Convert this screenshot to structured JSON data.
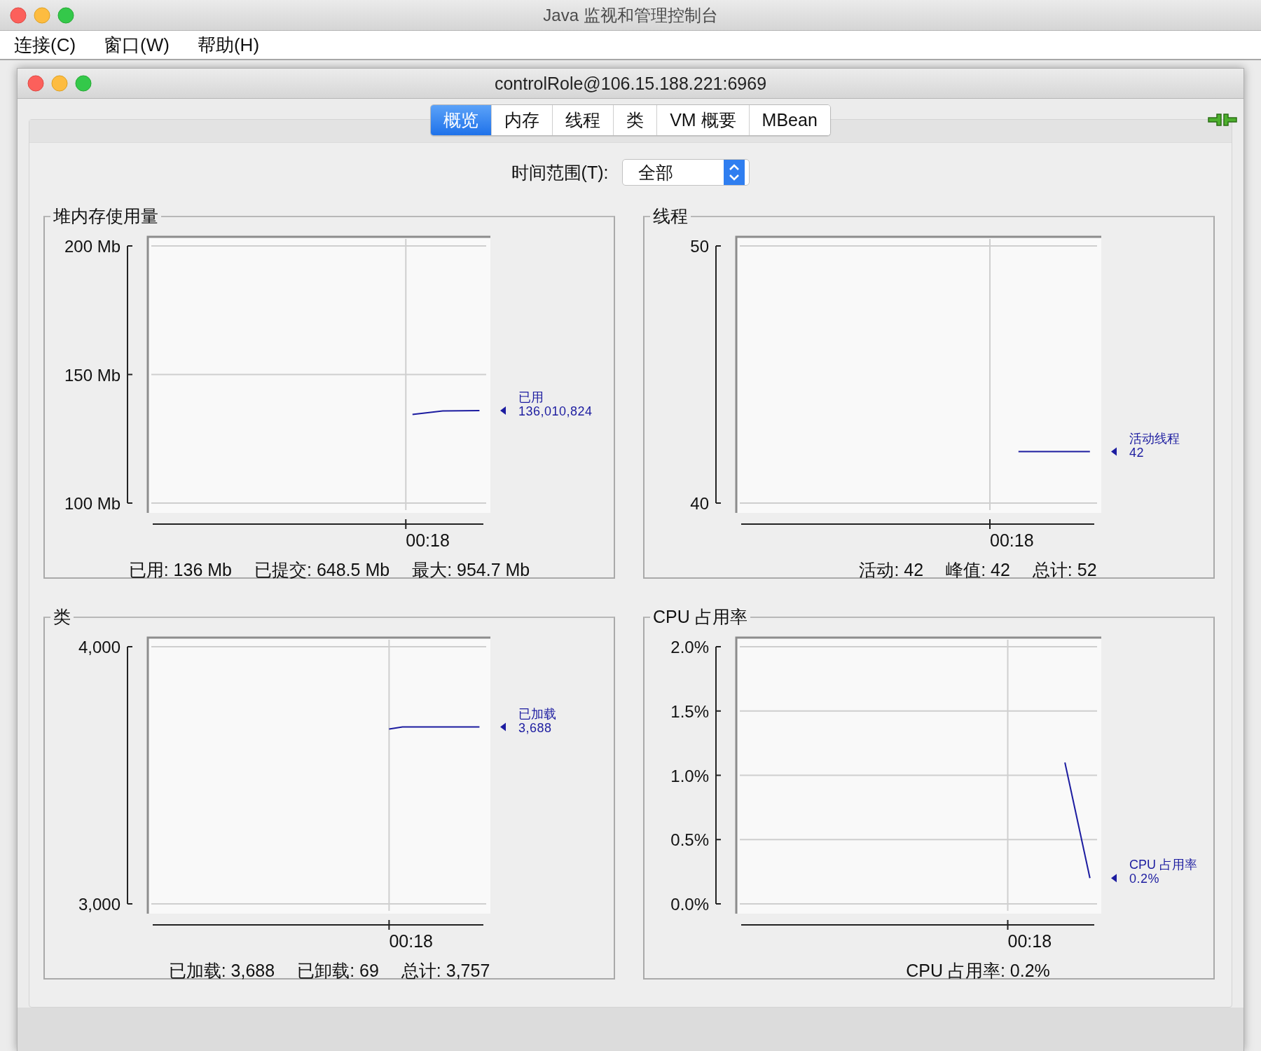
{
  "app_window": {
    "title": "Java 监视和管理控制台"
  },
  "menu": [
    {
      "label": "连接(C)"
    },
    {
      "label": "窗口(W)"
    },
    {
      "label": "帮助(H)"
    }
  ],
  "connection_window": {
    "title": "controlRole@106.15.188.221:6969"
  },
  "tabs": [
    {
      "label": "概览",
      "selected": true
    },
    {
      "label": "内存",
      "selected": false
    },
    {
      "label": "线程",
      "selected": false
    },
    {
      "label": "类",
      "selected": false
    },
    {
      "label": "VM 概要",
      "selected": false
    },
    {
      "label": "MBean",
      "selected": false
    }
  ],
  "time_range": {
    "label": "时间范围(T):",
    "value": "全部"
  },
  "panels": [
    {
      "kind": "memory",
      "title": "堆内存使用量",
      "y_labels": [
        "200 Mb",
        "150 Mb",
        "100 Mb"
      ],
      "time_label": "00:18",
      "legend_label": "已用",
      "legend_value": "136,010,824",
      "stats": [
        "已用: 136 Mb",
        "已提交: 648.5 Mb",
        "最大: 954.7 Mb"
      ]
    },
    {
      "kind": "threads",
      "title": "线程",
      "y_labels": [
        "50",
        "40"
      ],
      "time_label": "00:18",
      "legend_label": "活动线程",
      "legend_value": "42",
      "stats": [
        "活动: 42",
        "峰值: 42",
        "总计: 52"
      ]
    },
    {
      "kind": "classes",
      "title": "类",
      "y_labels": [
        "4,000",
        "3,000"
      ],
      "time_label": "00:18",
      "legend_label": "已加载",
      "legend_value": "3,688",
      "stats": [
        "已加载: 3,688",
        "已卸载: 69",
        "总计: 3,757"
      ]
    },
    {
      "kind": "cpu",
      "title": "CPU 占用率",
      "y_labels": [
        "2.0%",
        "1.5%",
        "1.0%",
        "0.5%",
        "0.0%"
      ],
      "time_label": "00:18",
      "legend_label": "CPU 占用率",
      "legend_value": "0.2%",
      "stats": [
        "CPU 占用率: 0.2%"
      ]
    }
  ]
}
